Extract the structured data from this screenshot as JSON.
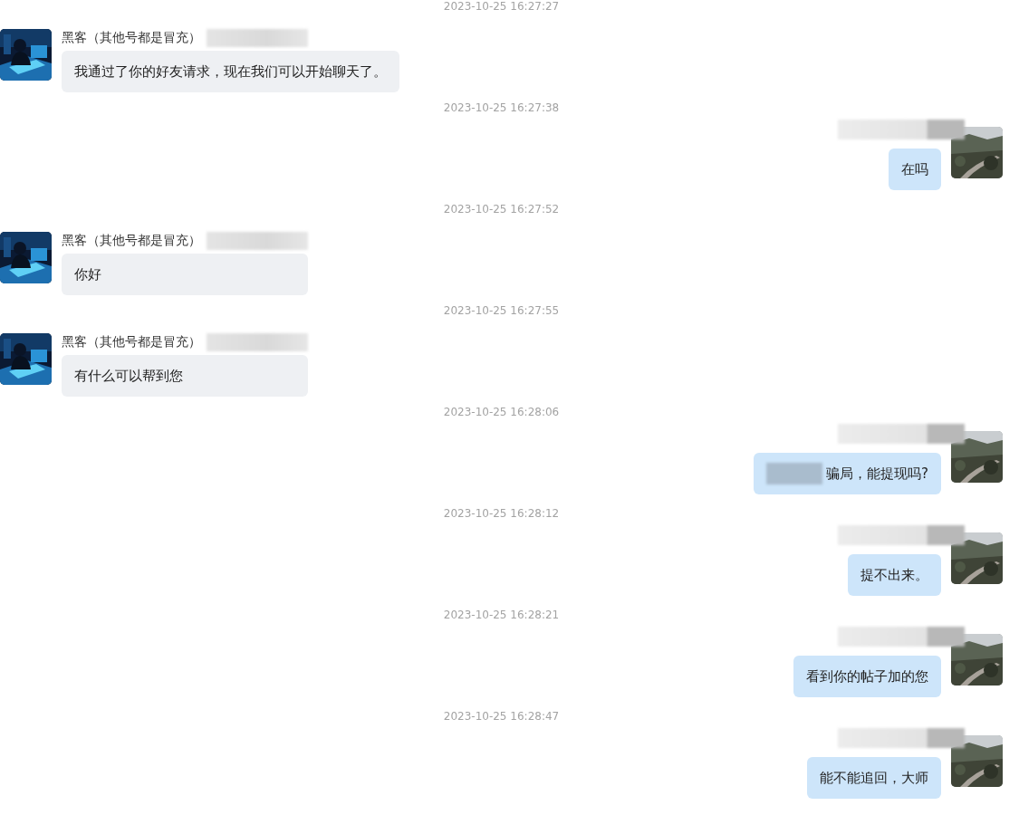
{
  "messages": [
    {
      "timestamp": "2023-10-25 16:27:27",
      "kind": "incoming",
      "sender": "黑客（其他号都是冒充）",
      "redacted_prefix": false,
      "text": "我通过了你的好友请求，现在我们可以开始聊天了。"
    },
    {
      "timestamp": "2023-10-25 16:27:38",
      "kind": "outgoing",
      "redacted_prefix": false,
      "text": "在吗"
    },
    {
      "timestamp": "2023-10-25 16:27:52",
      "kind": "incoming",
      "sender": "黑客（其他号都是冒充）",
      "redacted_prefix": false,
      "text": "你好"
    },
    {
      "timestamp": "2023-10-25 16:27:55",
      "kind": "incoming",
      "sender": "黑客（其他号都是冒充）",
      "redacted_prefix": false,
      "text": "有什么可以帮到您"
    },
    {
      "timestamp": "2023-10-25 16:28:06",
      "kind": "outgoing",
      "redacted_prefix": true,
      "text": "骗局，能提现吗?"
    },
    {
      "timestamp": "2023-10-25 16:28:12",
      "kind": "outgoing",
      "redacted_prefix": false,
      "text": "提不出来。"
    },
    {
      "timestamp": "2023-10-25 16:28:21",
      "kind": "outgoing",
      "redacted_prefix": false,
      "text": "看到你的帖子加的您"
    },
    {
      "timestamp": "2023-10-25 16:28:47",
      "kind": "outgoing",
      "redacted_prefix": false,
      "text": "能不能追回，大师"
    }
  ]
}
